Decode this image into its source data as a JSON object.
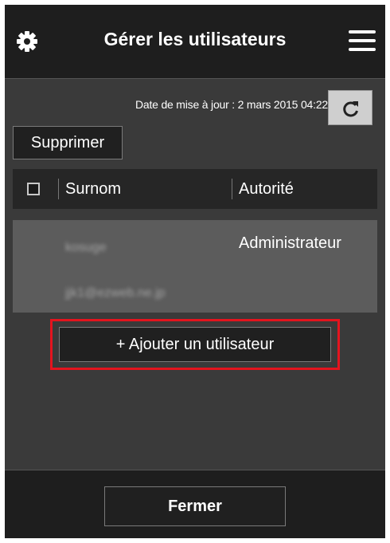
{
  "header": {
    "title": "Gérer les utilisateurs",
    "settings_icon": "gear-icon",
    "menu_icon": "hamburger-menu-icon"
  },
  "update": {
    "date_text": "Date de mise à jour : 2 mars 2015 04:22",
    "refresh_icon": "refresh-icon"
  },
  "toolbar": {
    "delete_label": "Supprimer"
  },
  "table": {
    "columns": [
      "Surnom",
      "Autorité"
    ],
    "rows": [
      {
        "nickname": "kosuge",
        "email": "jjk1@ezweb.ne.jp",
        "authority": "Administrateur"
      }
    ]
  },
  "add_user": {
    "label": "+ Ajouter un utilisateur",
    "highlight_color": "#e4141e"
  },
  "footer": {
    "close_label": "Fermer"
  }
}
